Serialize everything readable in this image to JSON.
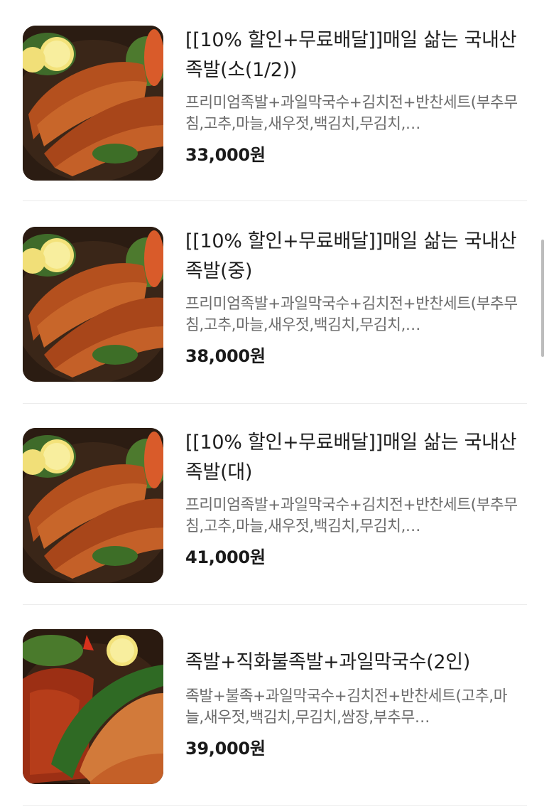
{
  "menu": {
    "items": [
      {
        "title": "[[10% 할인+무료배달]]매일 삶는 국내산 족발(소(1/2))",
        "description": "프리미엄족발+과일막국수+김치전+반찬세트(부추무침,고추,마늘,새우젓,백김치,무김치,…",
        "price": "33,000원",
        "image": "jokbal-photo"
      },
      {
        "title": "[[10% 할인+무료배달]]매일 삶는 국내산 족발(중)",
        "description": "프리미엄족발+과일막국수+김치전+반찬세트(부추무침,고추,마늘,새우젓,백김치,무김치,…",
        "price": "38,000원",
        "image": "jokbal-photo"
      },
      {
        "title": "[[10% 할인+무료배달]]매일 삶는 국내산 족발(대)",
        "description": "프리미엄족발+과일막국수+김치전+반찬세트(부추무침,고추,마늘,새우젓,백김치,무김치,…",
        "price": "41,000원",
        "image": "jokbal-photo"
      },
      {
        "title": "족발+직화불족발+과일막국수(2인)",
        "description": "족발+불족+과일막국수+김치전+반찬세트(고추,마늘,새우젓,백김치,무김치,쌈장,부추무…",
        "price": "39,000원",
        "image": "jokbal-spicy-photo"
      }
    ]
  },
  "colors": {
    "price": "#1a1a1a",
    "description": "#6b6b6b",
    "divider": "#ececec"
  }
}
